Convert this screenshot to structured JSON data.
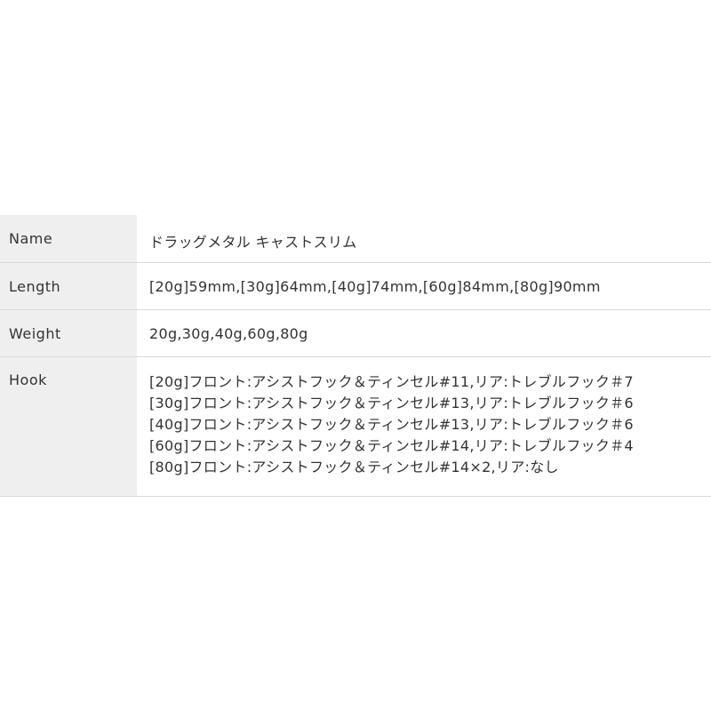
{
  "spec": {
    "name": {
      "label": "Name",
      "value": "ドラッグメタル キャストスリム"
    },
    "length": {
      "label": "Length",
      "value": "[20g]59mm,[30g]64mm,[40g]74mm,[60g]84mm,[80g]90mm"
    },
    "weight": {
      "label": "Weight",
      "value": "20g,30g,40g,60g,80g"
    },
    "hook": {
      "label": "Hook",
      "lines": [
        "[20g]フロント:アシストフック＆ティンセル#11,リア:トレブルフック＃7",
        "[30g]フロント:アシストフック＆ティンセル#13,リア:トレブルフック＃6",
        "[40g]フロント:アシストフック＆ティンセル#13,リア:トレブルフック＃6",
        "[60g]フロント:アシストフック＆ティンセル#14,リア:トレブルフック＃4",
        "[80g]フロント:アシストフック＆ティンセル#14×2,リア:なし"
      ]
    }
  },
  "colors": {
    "header_bg": "#efefef",
    "border": "#d9d9d9",
    "text": "#333333",
    "background": "#ffffff"
  }
}
